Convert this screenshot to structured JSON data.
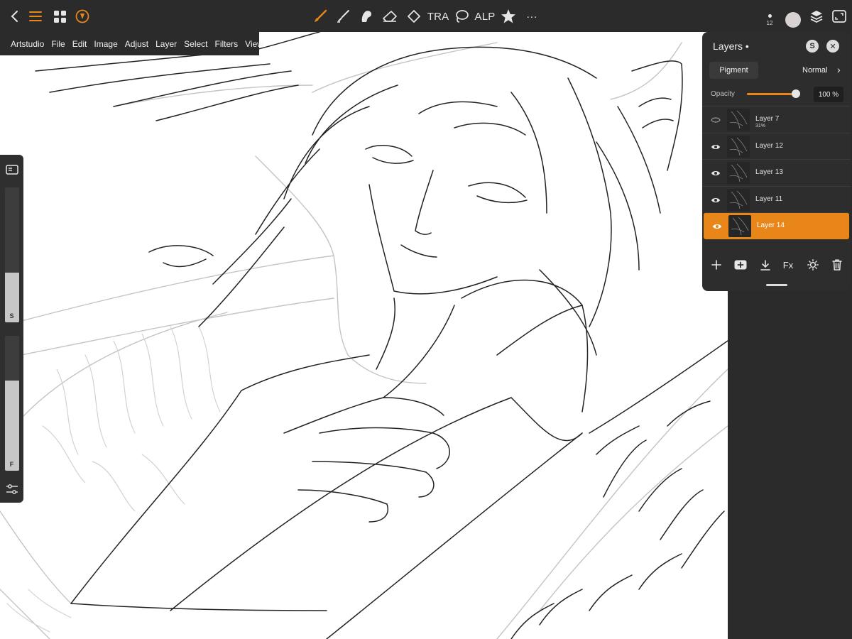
{
  "toolbar": {
    "tra_label": "TRA",
    "alp_label": "ALP",
    "more_label": "···",
    "brush_size": "12",
    "accent_color": "#e8861a",
    "current_color": "#d9d2d3"
  },
  "menu": {
    "items": [
      "Artstudio",
      "File",
      "Edit",
      "Image",
      "Adjust",
      "Layer",
      "Select",
      "Filters",
      "View"
    ]
  },
  "sidepanel": {
    "size_label": "S",
    "flow_label": "F",
    "size_value": 0.37,
    "flow_value": 0.67
  },
  "layers_panel": {
    "title": "Layers •",
    "s_button": "S",
    "close_button": "✕",
    "pigment_label": "Pigment",
    "blend_mode": "Normal",
    "opacity_label": "Opacity",
    "opacity_value": "100 %",
    "opacity_fraction": 1.0,
    "layers": [
      {
        "name": "Layer 7",
        "sub": "31%",
        "visible": false,
        "selected": false
      },
      {
        "name": "Layer 12",
        "sub": "",
        "visible": true,
        "selected": false
      },
      {
        "name": "Layer 13",
        "sub": "",
        "visible": true,
        "selected": false
      },
      {
        "name": "Layer 11",
        "sub": "",
        "visible": true,
        "selected": false
      },
      {
        "name": "Layer 14",
        "sub": "",
        "visible": true,
        "selected": true
      }
    ],
    "actions": {
      "fx_label": "Fx"
    }
  }
}
